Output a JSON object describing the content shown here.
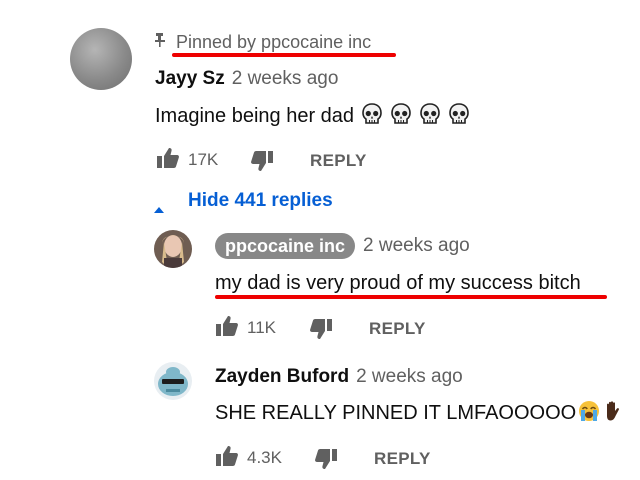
{
  "pinned": {
    "label": "Pinned by ppcocaine inc",
    "underline_color": "#e00000"
  },
  "comment": {
    "author": "Jayy Sz",
    "time": "2 weeks ago",
    "text": "Imagine being her dad",
    "emojis": [
      "skull-emoji",
      "skull-emoji",
      "skull-emoji",
      "skull-emoji"
    ],
    "likes": "17K",
    "reply_label": "REPLY"
  },
  "replies_toggle": {
    "label": "Hide 441 replies",
    "color": "#065fd4"
  },
  "replies": [
    {
      "author": "ppcocaine inc",
      "is_creator": true,
      "time": "2 weeks ago",
      "text": "my dad is very proud of my success bitch",
      "likes": "11K",
      "reply_label": "REPLY"
    },
    {
      "author": "Zayden Buford",
      "is_creator": false,
      "time": "2 weeks ago",
      "text": "SHE REALLY PINNED IT LMFAOOOOO",
      "emojis": [
        "loudly-crying-face-emoji",
        "raised-back-of-hand-emoji"
      ],
      "likes": "4.3K",
      "reply_label": "REPLY"
    }
  ]
}
